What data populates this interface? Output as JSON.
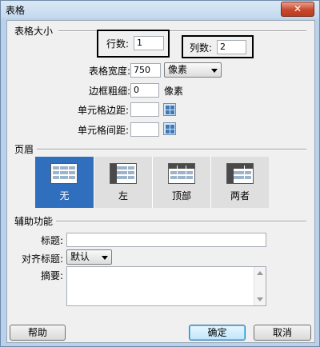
{
  "window": {
    "title": "表格",
    "close_glyph": "✕"
  },
  "table_size": {
    "section_label": "表格大小",
    "rows_label": "行数:",
    "rows_value": "1",
    "cols_label": "列数:",
    "cols_value": "2",
    "width_label": "表格宽度:",
    "width_value": "750",
    "width_unit": "像素",
    "border_label": "边框粗细:",
    "border_value": "0",
    "border_unit": "像素",
    "padding_label": "单元格边距:",
    "padding_value": "",
    "spacing_label": "单元格间距:",
    "spacing_value": ""
  },
  "header": {
    "section_label": "页眉",
    "options": [
      {
        "label": "无",
        "selected": true
      },
      {
        "label": "左",
        "selected": false
      },
      {
        "label": "顶部",
        "selected": false
      },
      {
        "label": "两者",
        "selected": false
      }
    ]
  },
  "accessibility": {
    "section_label": "辅助功能",
    "caption_label": "标题:",
    "caption_value": "",
    "align_label": "对齐标题:",
    "align_value": "默认",
    "summary_label": "摘要:",
    "summary_value": ""
  },
  "buttons": {
    "help": "帮助",
    "ok": "确定",
    "cancel": "取消"
  }
}
